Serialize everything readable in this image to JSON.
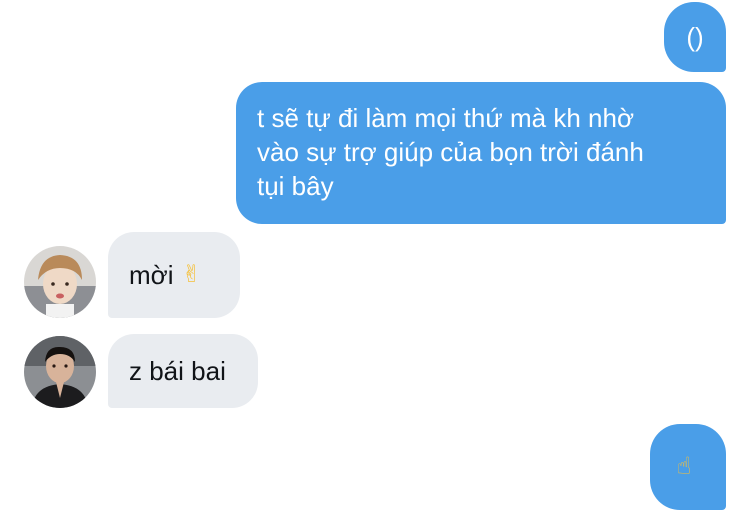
{
  "messages": [
    {
      "sender": "me",
      "text": "()"
    },
    {
      "sender": "me",
      "text": "t sẽ tự đi làm mọi thứ mà kh nhờ\nvào sự trợ giúp của bọn trời đánh\ntụi bây"
    },
    {
      "sender": "them",
      "text": "mời",
      "emoji": "✌"
    },
    {
      "sender": "them",
      "text": "z bái bai"
    },
    {
      "sender": "me",
      "emoji": "☝"
    }
  ],
  "colors": {
    "outgoing_bubble": "#4a9ee8",
    "incoming_bubble": "#e9ecf0",
    "outgoing_text": "#ffffff",
    "incoming_text": "#111418",
    "emoji_yellow": "#f5c03a"
  },
  "icons": {
    "avatar_1": "user-avatar-photo",
    "avatar_2": "user-avatar-photo",
    "emoji_1": "hand-gesture-emoji",
    "emoji_2": "pointing-finger-emoji"
  }
}
